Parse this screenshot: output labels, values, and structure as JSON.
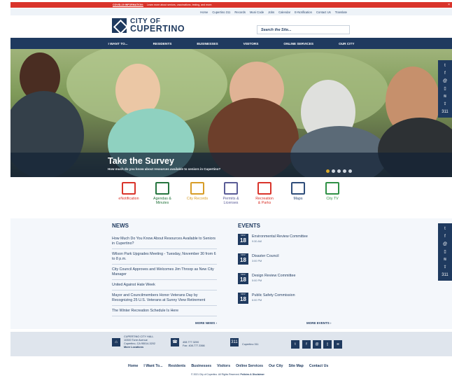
{
  "alert": {
    "label": "COVID-19 INFORMATION:",
    "text": "Learn more about seniors, vaccinations, testing, and more.",
    "close": "×"
  },
  "utility_links": [
    "Home",
    "Cupertino 311",
    "Records",
    "Muni Code",
    "Jobs",
    "Calendar",
    "E-Notification",
    "Contact Us",
    "Translate"
  ],
  "brand": {
    "line1": "CITY OF",
    "line2": "CUPERTINO"
  },
  "search": {
    "placeholder": "Search the Site..."
  },
  "nav": [
    "I WANT TO...",
    "RESIDENTS",
    "BUSINESSES",
    "VISITORS",
    "ONLINE SERVICES",
    "OUR CITY"
  ],
  "hero": {
    "title": "Take the Survey",
    "subtitle": "How much do you know about resources available to seniors in Cupertino?"
  },
  "quick_links": [
    "eNotification",
    "Agendas &\nMinutes",
    "City Records",
    "Permits &\nLicenses",
    "Recreation\n& Parks",
    "Maps",
    "City TV"
  ],
  "news": {
    "heading": "NEWS",
    "items": [
      "How Much Do You Know About Resources Available to Seniors in Cupertino?",
      "Wilson Park Upgrades Meeting - Tuesday, November 30 from 6 to 8 p.m.",
      "City Council Approves and Welcomes Jim Throop as New City Manager",
      "United Against Hate Week",
      "Mayor and Councilmembers Honor Veterans Day by Recognizing 25 U.S. Veterans at Sunny View Retirement",
      "The Winter Recreation Schedule Is Here"
    ],
    "more": "MORE NEWS ›"
  },
  "events": {
    "heading": "EVENTS",
    "items": [
      {
        "month": "NOV",
        "day": "18",
        "title": "Environmental Review Committee",
        "time": "9:30 AM"
      },
      {
        "month": "NOV",
        "day": "18",
        "title": "Disaster Council",
        "time": "3:00 PM"
      },
      {
        "month": "NOV",
        "day": "18",
        "title": "Design Review Committee",
        "time": "5:00 PM"
      },
      {
        "month": "NOV",
        "day": "18",
        "title": "Public Safety Commission",
        "time": "6:00 PM"
      }
    ],
    "more": "MORE EVENTS ›"
  },
  "footer": {
    "hall": "CUPERTINO CITY HALL",
    "address": "10300 Torre Avenue\nCupertino, CA 95014-3202",
    "locations": "More Locations",
    "phone": "408.777.3200",
    "fax": "Fax: 408.777.3366",
    "service": "Cupertino 311",
    "bottom_links": [
      "Home",
      "I Want To...",
      "Residents",
      "Businesses",
      "Visitors",
      "Online Services",
      "Our City",
      "Site Map",
      "Contact Us"
    ],
    "copyright": "© 2021 City of Cupertino. All Rights Reserved.",
    "policies": "Policies & Disclaimer"
  },
  "icons": [
    "twitter-icon",
    "facebook-icon",
    "email-icon",
    "mobile-icon",
    "rss-icon",
    "share-icon",
    "311-icon"
  ]
}
